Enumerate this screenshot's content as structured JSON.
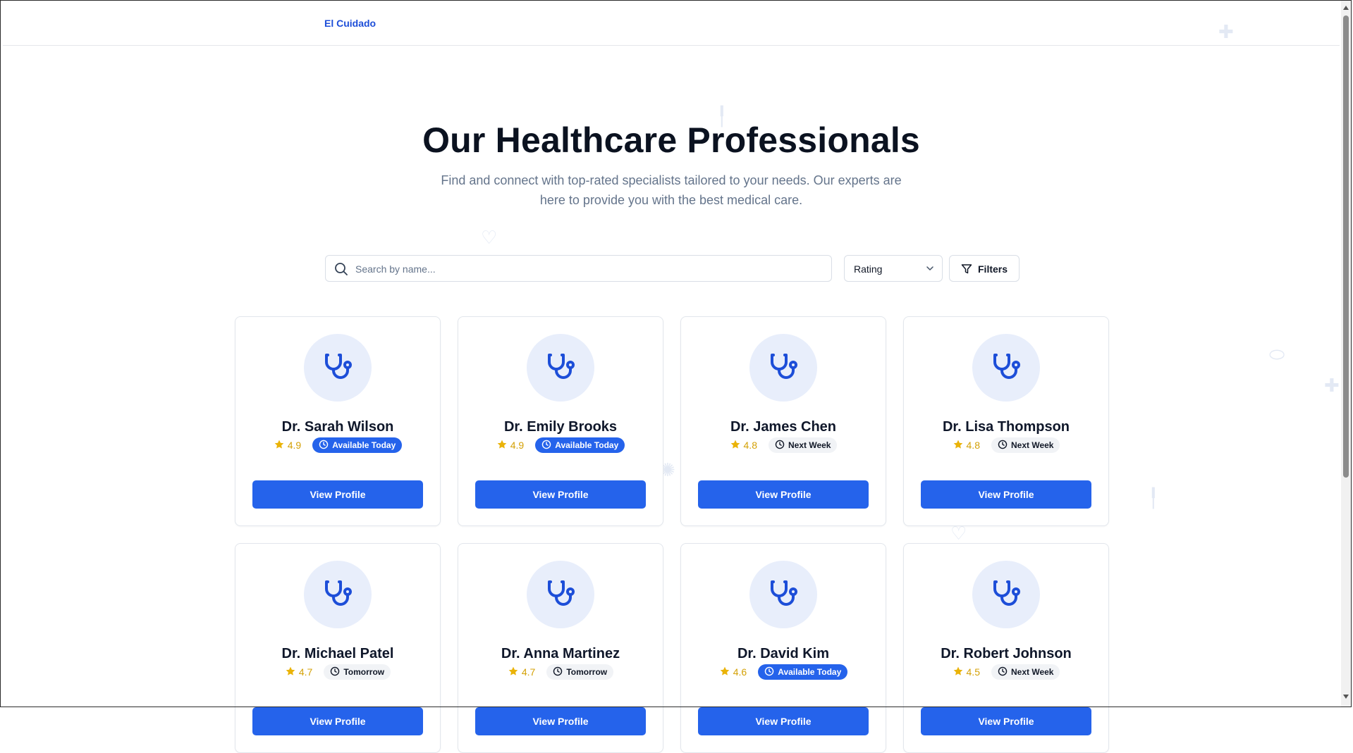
{
  "header": {
    "brand": "El Cuidado"
  },
  "hero": {
    "title": "Our Healthcare Professionals",
    "subtitle": "Find and connect with top-rated specialists tailored to your needs. Our experts are here to provide you with the best medical care."
  },
  "search": {
    "placeholder": "Search by name...",
    "value": ""
  },
  "sort": {
    "selected": "Rating"
  },
  "filters": {
    "label": "Filters"
  },
  "colors": {
    "primary": "#2563eb",
    "star": "#eab308",
    "avatar_bg": "#e8eefb"
  },
  "doctors": [
    {
      "name": "Dr. Sarah Wilson",
      "rating": "4.9",
      "availability": "Available Today",
      "button": "View Profile"
    },
    {
      "name": "Dr. Emily Brooks",
      "rating": "4.9",
      "availability": "Available Today",
      "button": "View Profile"
    },
    {
      "name": "Dr. James Chen",
      "rating": "4.8",
      "availability": "Next Week",
      "button": "View Profile"
    },
    {
      "name": "Dr. Lisa Thompson",
      "rating": "4.8",
      "availability": "Next Week",
      "button": "View Profile"
    },
    {
      "name": "Dr. Michael Patel",
      "rating": "4.7",
      "availability": "Tomorrow",
      "button": "View Profile"
    },
    {
      "name": "Dr. Anna Martinez",
      "rating": "4.7",
      "availability": "Tomorrow",
      "button": "View Profile"
    },
    {
      "name": "Dr. David Kim",
      "rating": "4.6",
      "availability": "Available Today",
      "button": "View Profile"
    },
    {
      "name": "Dr. Robert Johnson",
      "rating": "4.5",
      "availability": "Next Week",
      "button": "View Profile"
    }
  ]
}
